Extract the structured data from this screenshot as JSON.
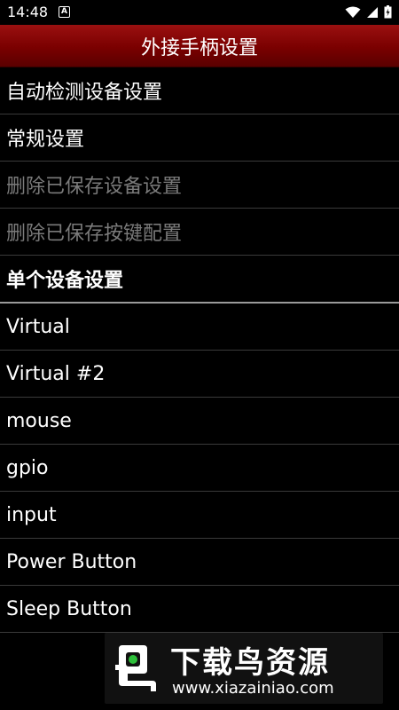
{
  "status": {
    "time": "14:48",
    "notification_letter": "A"
  },
  "header": {
    "title": "外接手柄设置"
  },
  "list": {
    "items": [
      {
        "label": "自动检测设备设置",
        "state": "enabled"
      },
      {
        "label": "常规设置",
        "state": "enabled"
      },
      {
        "label": "删除已保存设备设置",
        "state": "disabled"
      },
      {
        "label": "删除已保存按键配置",
        "state": "disabled"
      },
      {
        "label": "单个设备设置",
        "state": "section-header"
      },
      {
        "label": "Virtual",
        "state": "enabled"
      },
      {
        "label": "Virtual #2",
        "state": "enabled"
      },
      {
        "label": "mouse",
        "state": "enabled"
      },
      {
        "label": "gpio",
        "state": "enabled"
      },
      {
        "label": "input",
        "state": "enabled"
      },
      {
        "label": "Power Button",
        "state": "enabled"
      },
      {
        "label": "Sleep Button",
        "state": "enabled"
      }
    ]
  },
  "watermark": {
    "name": "下载鸟资源",
    "url": "www.xiazainiao.com"
  },
  "colors": {
    "titlebar": "#7a0000",
    "background": "#000000",
    "disabled_text": "#7a7a7a",
    "logo_green": "#2dbf3a"
  }
}
